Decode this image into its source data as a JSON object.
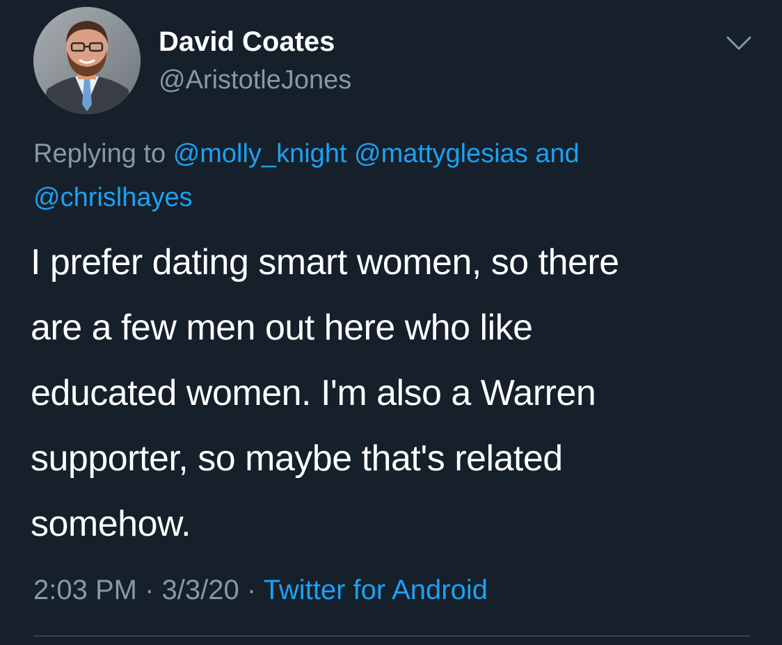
{
  "user": {
    "display_name": "David Coates",
    "handle": "@AristotleJones"
  },
  "reply": {
    "prefix": "Replying to",
    "mentions": [
      "@molly_knight",
      "@mattyglesias",
      "@chrislhayes"
    ],
    "conjunction": "and"
  },
  "tweet": {
    "lines": [
      "I prefer dating smart women, so there",
      "are a few men out here who like",
      "educated women. I'm also a Warren",
      "supporter, so maybe that's related",
      "somehow."
    ]
  },
  "meta": {
    "time": "2:03 PM",
    "separator": "·",
    "date": "3/3/20",
    "source": "Twitter for Android"
  },
  "icons": {
    "menu": "chevron-down-icon"
  },
  "colors": {
    "background": "#15202b",
    "primary_text": "#ffffff",
    "secondary_text": "#8899a6",
    "link": "#1da1f2",
    "divider": "#38444d"
  }
}
